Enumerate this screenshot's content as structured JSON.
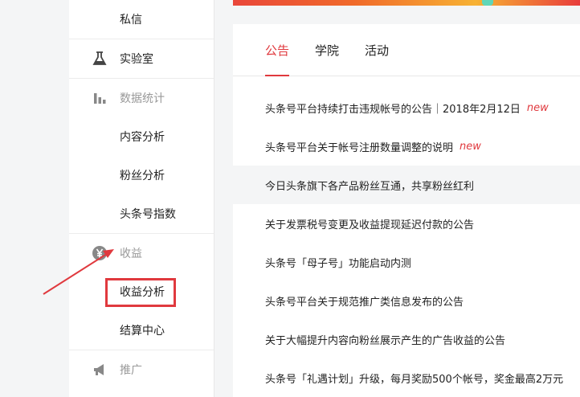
{
  "sidebar": {
    "items": [
      {
        "label": "私信"
      },
      {
        "label": "实验室"
      },
      {
        "label": "数据统计"
      },
      {
        "label": "内容分析"
      },
      {
        "label": "粉丝分析"
      },
      {
        "label": "头条号指数"
      },
      {
        "label": "收益"
      },
      {
        "label": "收益分析"
      },
      {
        "label": "结算中心"
      },
      {
        "label": "推广"
      }
    ]
  },
  "tabs": [
    {
      "label": "公告",
      "active": true
    },
    {
      "label": "学院"
    },
    {
      "label": "活动"
    }
  ],
  "notices": [
    {
      "text": "头条号平台持续打击违规帐号的公告｜2018年2月12日",
      "badge": "new"
    },
    {
      "text": "头条号平台关于帐号注册数量调整的说明",
      "badge": "new"
    },
    {
      "text": "今日头条旗下各产品粉丝互通，共享粉丝红利",
      "badge": ""
    },
    {
      "text": "关于发票税号变更及收益提现延迟付款的公告",
      "badge": ""
    },
    {
      "text": "头条号「母子号」功能启动内测",
      "badge": ""
    },
    {
      "text": "头条号平台关于规范推广类信息发布的公告",
      "badge": ""
    },
    {
      "text": "关于大幅提升内容向粉丝展示产生的广告收益的公告",
      "badge": ""
    },
    {
      "text": "头条号「礼遇计划」升级，每月奖励500个帐号，奖金最高2万元",
      "badge": ""
    }
  ],
  "colors": {
    "accent": "#e0393e",
    "muted": "#999999",
    "annotation": "#e0393e"
  }
}
